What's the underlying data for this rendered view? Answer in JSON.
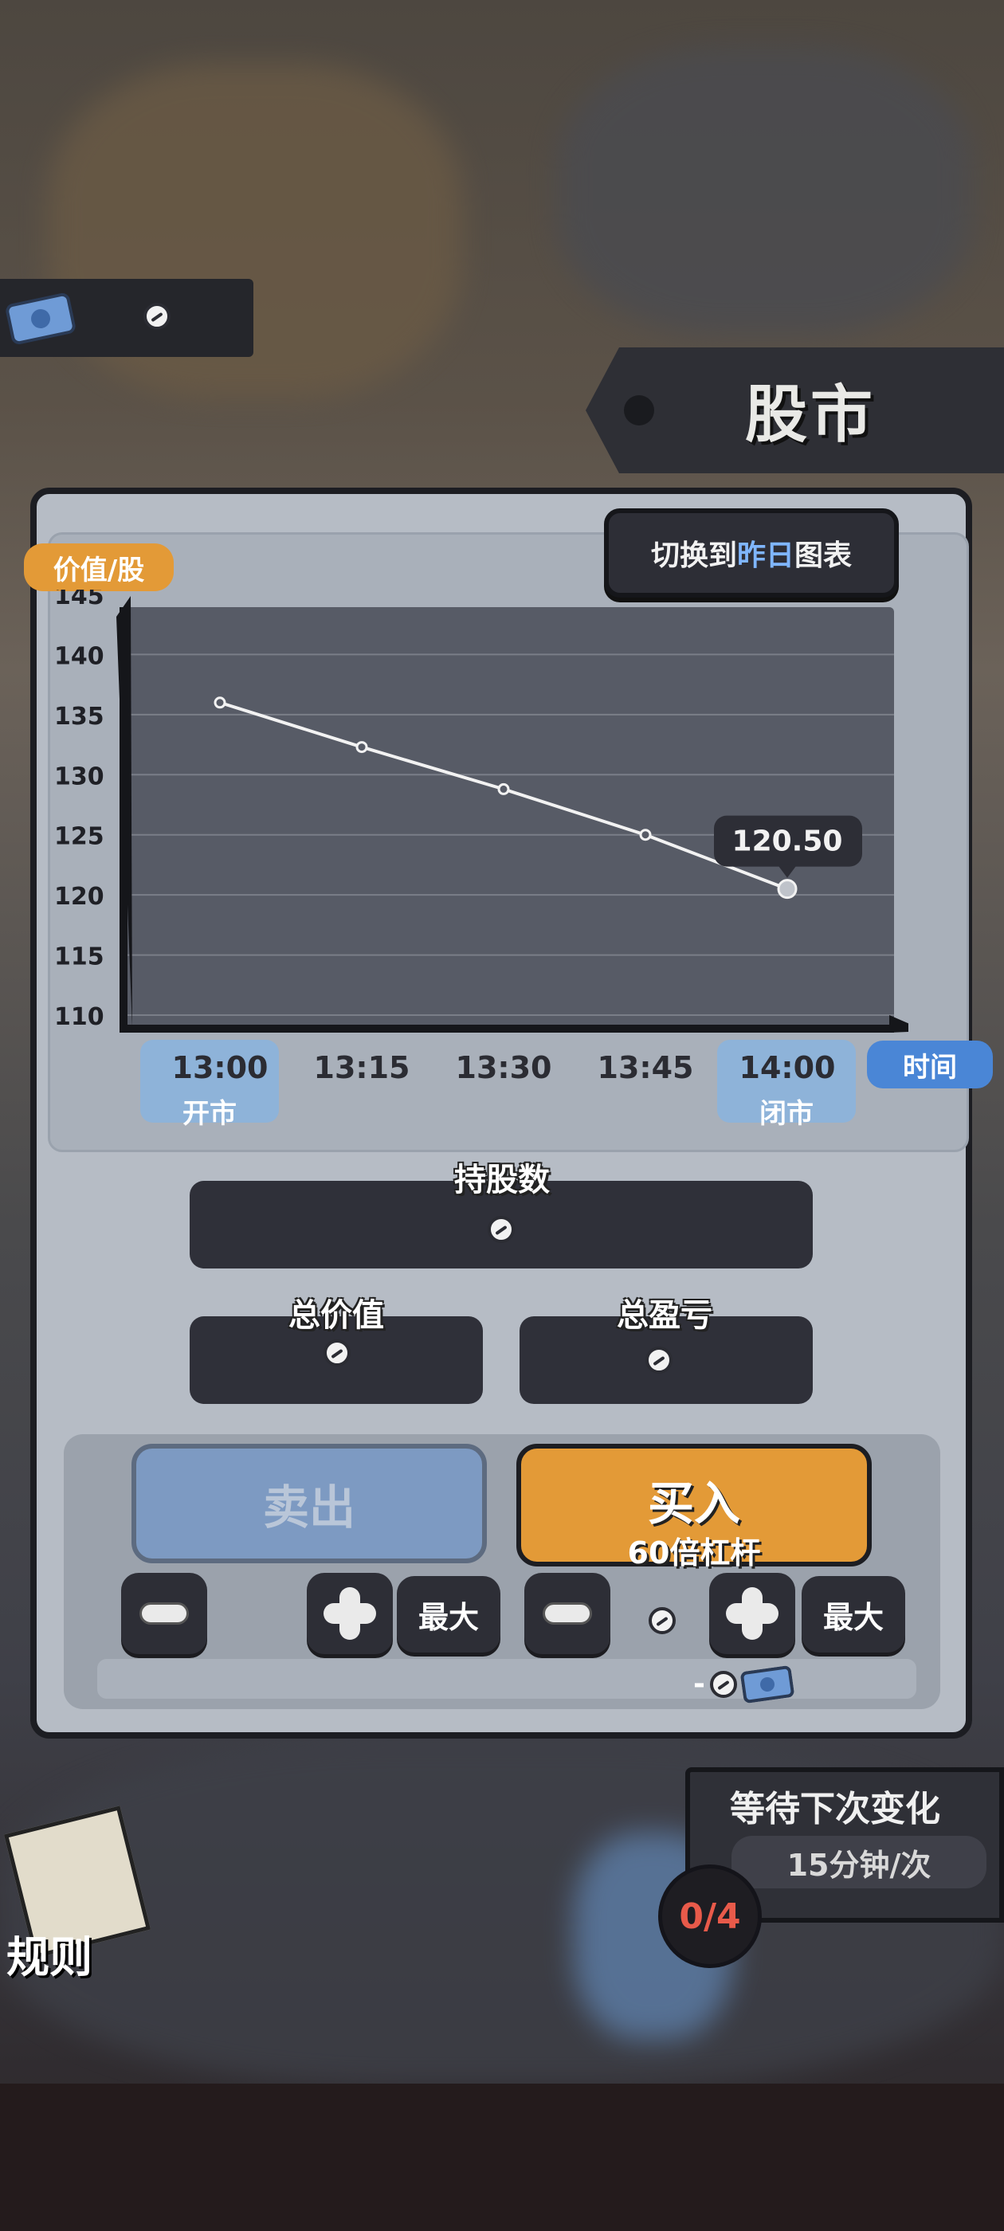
{
  "header": {
    "title": "股市",
    "currency_value_icon": "zero-coin-icon"
  },
  "chart": {
    "switch_button": {
      "prefix": "切换到",
      "highlight": "昨日",
      "suffix": "图表",
      "highlight_color": "#7fb6ff"
    },
    "y_axis_label": "价值/股",
    "x_axis_label": "时间",
    "current_price_label": "120.50",
    "open_label": "开市",
    "close_label": "闭市"
  },
  "chart_data": {
    "type": "line",
    "x": [
      "13:00",
      "13:15",
      "13:30",
      "13:45",
      "14:00"
    ],
    "series": [
      {
        "values": [
          136,
          132.3,
          128.8,
          125,
          120.5
        ]
      }
    ],
    "y_ticks": [
      145,
      140,
      135,
      130,
      125,
      120,
      115,
      110
    ],
    "ylim": [
      110,
      145
    ],
    "xlabel": "时间",
    "ylabel": "价值/股",
    "annotation": "120.50",
    "grid": true
  },
  "holdings": {
    "shares_label": "持股数",
    "total_value_label": "总价值",
    "total_pnl_label": "总盈亏"
  },
  "trade": {
    "sell_label": "卖出",
    "buy_label": "买入",
    "leverage_label": "60倍杠杆",
    "max_label": "最大",
    "cost_prefix": "-"
  },
  "wait": {
    "title": "等待下次变化",
    "interval": "15分钟/次",
    "counter": "0/4"
  },
  "rules": {
    "label": "规则"
  },
  "colors": {
    "accent_orange": "#e39a37",
    "accent_blue": "#4a86d6",
    "panel": "#b6bcc5",
    "dark": "#2d2e36"
  }
}
